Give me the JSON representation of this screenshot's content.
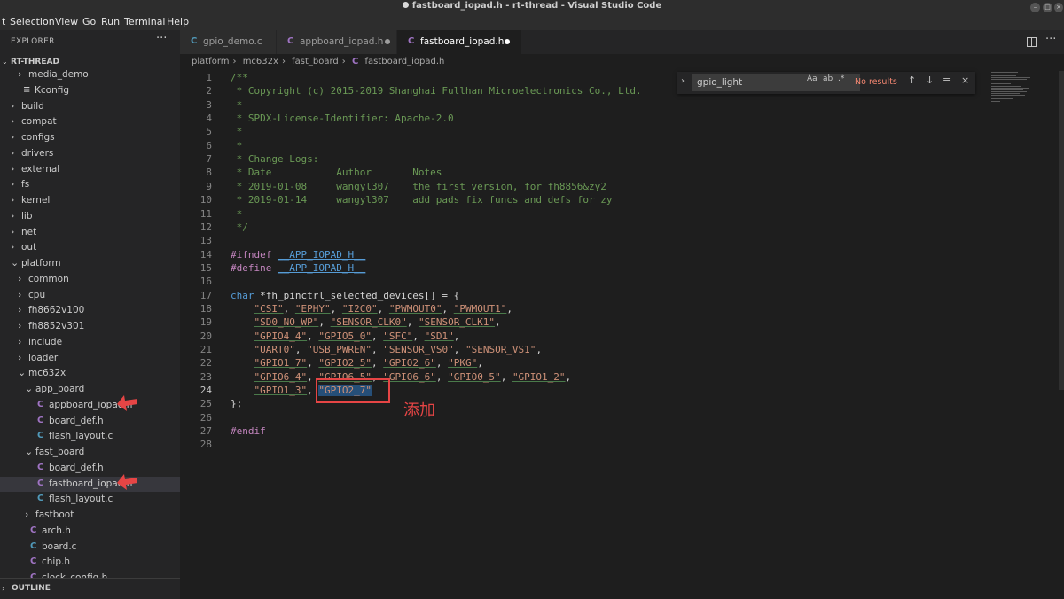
{
  "window": {
    "title": "fastboard_iopad.h - rt-thread - Visual Studio Code"
  },
  "menu": [
    "t",
    "Selection",
    "View",
    "Go",
    "Run",
    "Terminal",
    "Help"
  ],
  "explorer": {
    "title": "EXPLORER",
    "project": "RT-THREAD",
    "tree": [
      {
        "label": "media_demo",
        "kind": "folder",
        "depth": 1,
        "state": "collapsed"
      },
      {
        "label": "Kconfig",
        "kind": "file-kconfig",
        "depth": 1
      },
      {
        "label": "build",
        "kind": "folder",
        "depth": 0,
        "state": "collapsed"
      },
      {
        "label": "compat",
        "kind": "folder",
        "depth": 0,
        "state": "collapsed"
      },
      {
        "label": "configs",
        "kind": "folder",
        "depth": 0,
        "state": "collapsed"
      },
      {
        "label": "drivers",
        "kind": "folder",
        "depth": 0,
        "state": "collapsed"
      },
      {
        "label": "external",
        "kind": "folder",
        "depth": 0,
        "state": "collapsed"
      },
      {
        "label": "fs",
        "kind": "folder",
        "depth": 0,
        "state": "collapsed"
      },
      {
        "label": "kernel",
        "kind": "folder",
        "depth": 0,
        "state": "collapsed"
      },
      {
        "label": "lib",
        "kind": "folder",
        "depth": 0,
        "state": "collapsed"
      },
      {
        "label": "net",
        "kind": "folder",
        "depth": 0,
        "state": "collapsed"
      },
      {
        "label": "out",
        "kind": "folder",
        "depth": 0,
        "state": "collapsed"
      },
      {
        "label": "platform",
        "kind": "folder",
        "depth": 0,
        "state": "expanded"
      },
      {
        "label": "common",
        "kind": "folder",
        "depth": 1,
        "state": "collapsed"
      },
      {
        "label": "cpu",
        "kind": "folder",
        "depth": 1,
        "state": "collapsed"
      },
      {
        "label": "fh8662v100",
        "kind": "folder",
        "depth": 1,
        "state": "collapsed"
      },
      {
        "label": "fh8852v301",
        "kind": "folder",
        "depth": 1,
        "state": "collapsed"
      },
      {
        "label": "include",
        "kind": "folder",
        "depth": 1,
        "state": "collapsed"
      },
      {
        "label": "loader",
        "kind": "folder",
        "depth": 1,
        "state": "collapsed"
      },
      {
        "label": "mc632x",
        "kind": "folder",
        "depth": 1,
        "state": "expanded"
      },
      {
        "label": "app_board",
        "kind": "folder",
        "depth": 2,
        "state": "expanded"
      },
      {
        "label": "appboard_iopad.h",
        "kind": "file-h",
        "depth": 3
      },
      {
        "label": "board_def.h",
        "kind": "file-h",
        "depth": 3
      },
      {
        "label": "flash_layout.c",
        "kind": "file-c",
        "depth": 3
      },
      {
        "label": "fast_board",
        "kind": "folder",
        "depth": 2,
        "state": "expanded"
      },
      {
        "label": "board_def.h",
        "kind": "file-h",
        "depth": 3
      },
      {
        "label": "fastboard_iopad.h",
        "kind": "file-h",
        "depth": 3,
        "selected": true
      },
      {
        "label": "flash_layout.c",
        "kind": "file-c",
        "depth": 3
      },
      {
        "label": "fastboot",
        "kind": "folder",
        "depth": 2,
        "state": "collapsed"
      },
      {
        "label": "arch.h",
        "kind": "file-h",
        "depth": 2
      },
      {
        "label": "board.c",
        "kind": "file-c",
        "depth": 2
      },
      {
        "label": "chip.h",
        "kind": "file-h",
        "depth": 2
      },
      {
        "label": "clock_config.h",
        "kind": "file-h",
        "depth": 2
      }
    ],
    "outline_label": "OUTLINE"
  },
  "tabs": [
    {
      "label": "gpio_demo.c",
      "icon": "c-file-icon",
      "icon_letter": "C",
      "icon_color": "#519aba",
      "active": false,
      "modified": false
    },
    {
      "label": "appboard_iopad.h",
      "icon": "h-file-icon",
      "icon_letter": "C",
      "icon_color": "#a074c4",
      "active": false,
      "modified": true
    },
    {
      "label": "fastboard_iopad.h",
      "icon": "h-file-icon",
      "icon_letter": "C",
      "icon_color": "#a074c4",
      "active": true,
      "modified": true
    }
  ],
  "breadcrumb": [
    "platform",
    "mc632x",
    "fast_board",
    "fastboard_iopad.h"
  ],
  "find": {
    "value": "gpio_light",
    "options": [
      "Aa",
      "ab",
      ".*"
    ],
    "result": "No results"
  },
  "code": {
    "current_line": 24,
    "lines": [
      [
        [
          "comment",
          "/**"
        ]
      ],
      [
        [
          "comment",
          " * Copyright (c) 2015-2019 Shanghai Fullhan Microelectronics Co., Ltd."
        ]
      ],
      [
        [
          "comment",
          " *"
        ]
      ],
      [
        [
          "comment",
          " * SPDX-License-Identifier: Apache-2.0"
        ]
      ],
      [
        [
          "comment",
          " *"
        ]
      ],
      [
        [
          "comment",
          " *"
        ]
      ],
      [
        [
          "comment",
          " * Change Logs:"
        ]
      ],
      [
        [
          "comment",
          " * Date           Author       Notes"
        ]
      ],
      [
        [
          "comment",
          " * 2019-01-08     wangyl307    the first version, for fh8856&zy2"
        ]
      ],
      [
        [
          "comment",
          " * 2019-01-14     wangyl307    add pads fix funcs and defs for zy"
        ]
      ],
      [
        [
          "comment",
          " *"
        ]
      ],
      [
        [
          "comment",
          " */"
        ]
      ],
      [],
      [
        [
          "macro",
          "#ifndef "
        ],
        [
          "ident",
          "__APP_IOPAD_H__"
        ]
      ],
      [
        [
          "macro",
          "#define "
        ],
        [
          "ident",
          "__APP_IOPAD_H__"
        ]
      ],
      [],
      [
        [
          "type",
          "char "
        ],
        [
          "plain",
          "*fh_pinctrl_selected_devices[] = {"
        ]
      ],
      [
        [
          "plain",
          "    "
        ],
        [
          "str",
          "\"CSI\""
        ],
        [
          "plain",
          ", "
        ],
        [
          "str",
          "\"EPHY\""
        ],
        [
          "plain",
          ", "
        ],
        [
          "str",
          "\"I2C0\""
        ],
        [
          "plain",
          ", "
        ],
        [
          "str",
          "\"PWMOUT0\""
        ],
        [
          "plain",
          ", "
        ],
        [
          "str",
          "\"PWMOUT1\""
        ],
        [
          "plain",
          ","
        ]
      ],
      [
        [
          "plain",
          "    "
        ],
        [
          "str",
          "\"SD0_NO_WP\""
        ],
        [
          "plain",
          ", "
        ],
        [
          "str",
          "\"SENSOR_CLK0\""
        ],
        [
          "plain",
          ", "
        ],
        [
          "str",
          "\"SENSOR_CLK1\""
        ],
        [
          "plain",
          ","
        ]
      ],
      [
        [
          "plain",
          "    "
        ],
        [
          "str",
          "\"GPIO4_4\""
        ],
        [
          "plain",
          ", "
        ],
        [
          "str",
          "\"GPIO5_0\""
        ],
        [
          "plain",
          ", "
        ],
        [
          "str",
          "\"SFC\""
        ],
        [
          "plain",
          ", "
        ],
        [
          "str",
          "\"SD1\""
        ],
        [
          "plain",
          ","
        ]
      ],
      [
        [
          "plain",
          "    "
        ],
        [
          "str",
          "\"UART0\""
        ],
        [
          "plain",
          ", "
        ],
        [
          "str",
          "\"USB_PWREN\""
        ],
        [
          "plain",
          ", "
        ],
        [
          "str",
          "\"SENSOR_VS0\""
        ],
        [
          "plain",
          ", "
        ],
        [
          "str",
          "\"SENSOR_VS1\""
        ],
        [
          "plain",
          ","
        ]
      ],
      [
        [
          "plain",
          "    "
        ],
        [
          "str",
          "\"GPIO1_7\""
        ],
        [
          "plain",
          ", "
        ],
        [
          "str",
          "\"GPIO2_5\""
        ],
        [
          "plain",
          ", "
        ],
        [
          "str",
          "\"GPIO2_6\""
        ],
        [
          "plain",
          ", "
        ],
        [
          "str",
          "\"PKG\""
        ],
        [
          "plain",
          ","
        ]
      ],
      [
        [
          "plain",
          "    "
        ],
        [
          "str",
          "\"GPIO6_4\""
        ],
        [
          "plain",
          ", "
        ],
        [
          "str",
          "\"GPIO6_5\""
        ],
        [
          "plain",
          ", "
        ],
        [
          "str",
          "\"GPIO6_6\""
        ],
        [
          "plain",
          ", "
        ],
        [
          "str",
          "\"GPIO0_5\""
        ],
        [
          "plain",
          ", "
        ],
        [
          "str",
          "\"GPIO1_2\""
        ],
        [
          "plain",
          ","
        ]
      ],
      [
        [
          "plain",
          "    "
        ],
        [
          "str",
          "\"GPIO1_3\""
        ],
        [
          "plain",
          ", "
        ],
        [
          "sel",
          "\"GPIO2_7\""
        ]
      ],
      [
        [
          "plain",
          "};"
        ]
      ],
      [],
      [
        [
          "macro",
          "#endif"
        ]
      ],
      []
    ]
  },
  "annotation": {
    "text": "添加",
    "color": "#e64545"
  },
  "colors": {
    "folder_chevron": "#c5c5c5",
    "c_icon": "#519aba",
    "h_icon": "#a074c4",
    "kconfig_icon": "#cccccc"
  }
}
